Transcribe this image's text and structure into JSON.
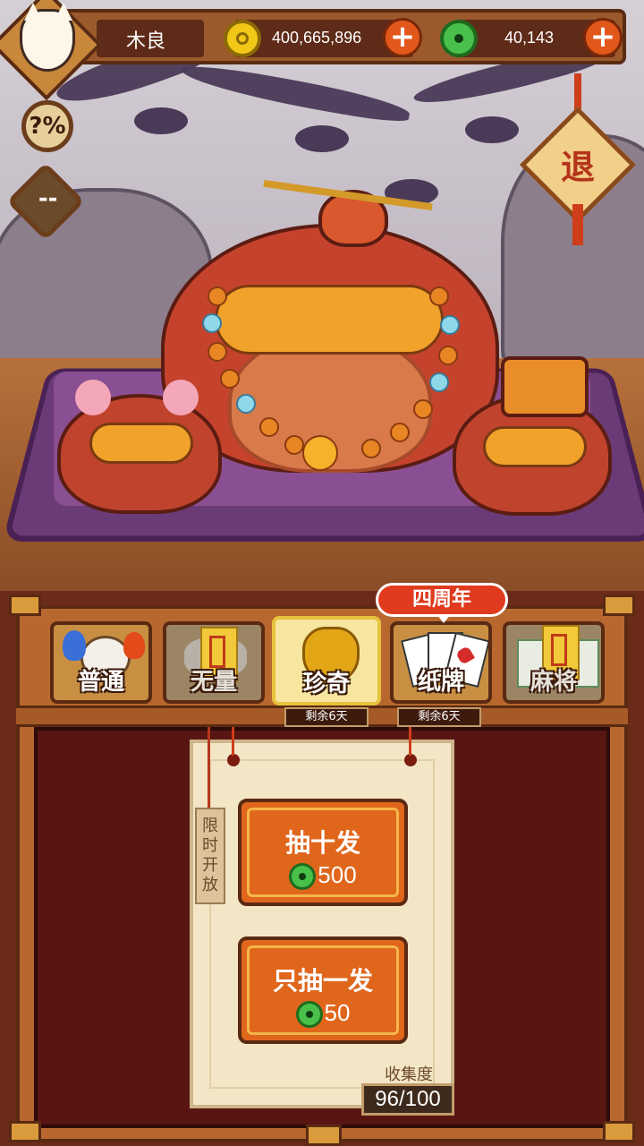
{
  "header": {
    "player_name": "木良",
    "gold_amount": "400,665,896",
    "jade_amount": "40,143",
    "plus_symbol": "+"
  },
  "side_buttons": {
    "help_label": "?%",
    "chat_label": "--",
    "exit_label": "退"
  },
  "tabs": [
    {
      "label": "普通",
      "icon": "mouse-icon"
    },
    {
      "label": "无量",
      "icon": "bull-talisman-icon"
    },
    {
      "label": "珍奇",
      "icon": "golden-mask-icon"
    },
    {
      "label": "纸牌",
      "icon": "playing-cards-icon"
    },
    {
      "label": "麻将",
      "icon": "mahjong-talisman-icon"
    }
  ],
  "badge": "四周年",
  "remaining": [
    "剩余6天",
    "剩余6天"
  ],
  "scroll": {
    "tag_text": "限时开放",
    "draw_ten_label": "抽十发",
    "draw_ten_cost": "500",
    "draw_one_label": "只抽一发",
    "draw_one_cost": "50",
    "collection_label": "收集度",
    "collection_value": "96/100"
  },
  "colors": {
    "panel": "#6c2a18",
    "accent_orange": "#e0661c",
    "jade": "#48c04a",
    "gold": "#f2c818"
  }
}
